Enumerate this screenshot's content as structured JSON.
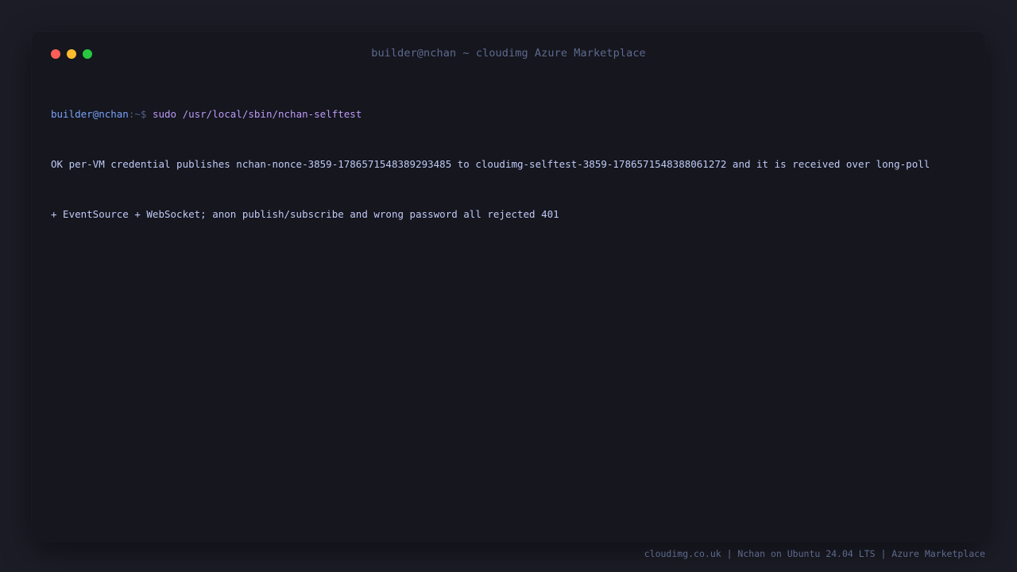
{
  "window": {
    "title": "builder@nchan ~ cloudimg Azure Marketplace",
    "controls": {
      "close_color": "#ff5f57",
      "minimize_color": "#febc2e",
      "maximize_color": "#28c840"
    }
  },
  "terminal": {
    "prompt_user": "builder@nchan",
    "prompt_sep": ":~$ ",
    "command": "sudo /usr/local/sbin/nchan-selftest",
    "output": [
      "OK per-VM credential publishes nchan-nonce-3859-1786571548389293485 to cloudimg-selftest-3859-1786571548388061272 and it is received over long-poll",
      "+ EventSource + WebSocket; anon publish/subscribe and wrong password all rejected 401"
    ]
  },
  "footer": {
    "text": "cloudimg.co.uk | Nchan on Ubuntu 24.04 LTS | Azure Marketplace"
  }
}
